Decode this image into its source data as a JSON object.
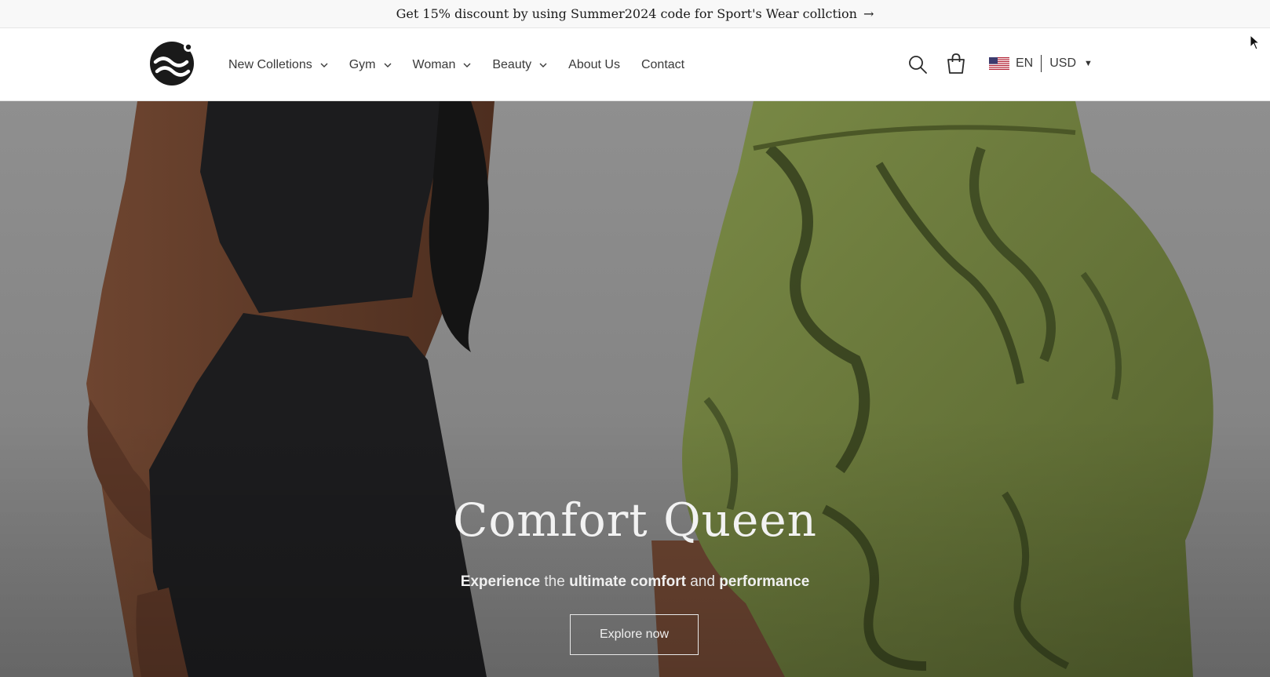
{
  "announcement": {
    "text": "Get 15% discount by using Summer2024 code for Sport's Wear collction",
    "arrow": "→"
  },
  "header": {
    "logo_icon": "wave-logo-icon",
    "nav": [
      {
        "label": "New Colletions",
        "has_dropdown": true
      },
      {
        "label": "Gym",
        "has_dropdown": true
      },
      {
        "label": "Woman",
        "has_dropdown": true
      },
      {
        "label": "Beauty",
        "has_dropdown": true
      },
      {
        "label": "About Us",
        "has_dropdown": false
      },
      {
        "label": "Contact",
        "has_dropdown": false
      }
    ],
    "search_icon": "search-icon",
    "cart_icon": "cart-icon",
    "locale": {
      "flag_icon": "us-flag-icon",
      "language": "EN",
      "currency": "USD"
    }
  },
  "hero": {
    "title": "Comfort Queen",
    "subtitle": {
      "w1": "Experience",
      "w2": "the",
      "w3": "ultimate comfort",
      "w4": "and",
      "w5": "performance"
    },
    "cta": "Explore now"
  },
  "colors": {
    "announcement_bg": "#f8f8f8",
    "hero_bg": "#8d8d8d",
    "text_dark": "#3a3a3a",
    "shorts_green": "#6f7d3f",
    "outfit_black": "#1c1c1e"
  }
}
